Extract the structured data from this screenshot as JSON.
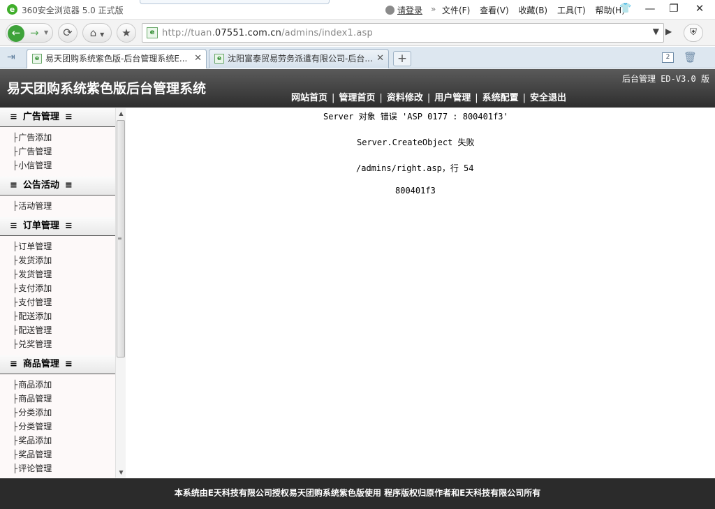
{
  "browser": {
    "title": "360安全浏览器 5.0 正式版",
    "login": "请登录",
    "menus": [
      "文件(F)",
      "查看(V)",
      "收藏(B)",
      "工具(T)",
      "帮助(H)"
    ],
    "url_prefix": "http://tuan.",
    "url_domain": "07551.com.cn",
    "url_path": "/admins/index1.asp",
    "tabs": [
      {
        "title": "易天团购系统紫色版-后台管理系统E...",
        "active": true
      },
      {
        "title": "沈阳富泰贸易劳务派遣有限公司-后台...",
        "active": false
      }
    ],
    "tab_count": "2",
    "icons": {
      "back": "back-arrow-icon",
      "forward": "forward-arrow-icon",
      "refresh": "refresh-icon",
      "home": "home-icon",
      "favorite": "star-icon",
      "security": "shield-icon"
    }
  },
  "header": {
    "system_title": "易天团购系统紫色版后台管理系统",
    "version_label": "后台管理",
    "version_code": "ED-V3.0 版",
    "nav": [
      "网站首页",
      "管理首页",
      "资料修改",
      "用户管理",
      "系统配置",
      "安全退出"
    ]
  },
  "sidebar": {
    "sections": [
      {
        "title": "广告管理",
        "items": [
          "广告添加",
          "广告管理",
          "小信管理"
        ]
      },
      {
        "title": "公告活动",
        "items": [
          "活动管理"
        ]
      },
      {
        "title": "订单管理",
        "items": [
          "订单管理",
          "发货添加",
          "发货管理",
          "支付添加",
          "支付管理",
          "配送添加",
          "配送管理",
          "兑奖管理"
        ]
      },
      {
        "title": "商品管理",
        "items": [
          "商品添加",
          "商品管理",
          "分类添加",
          "分类管理",
          "奖品添加",
          "奖品管理",
          "评论管理"
        ]
      }
    ]
  },
  "main": {
    "error_line1": "Server 对象 错误 'ASP 0177 : 800401f3'",
    "error_line2": "Server.CreateObject 失败",
    "error_line3": "/admins/right.asp，行 54",
    "error_line4": "800401f3"
  },
  "footer": {
    "text": "本系统由E天科技有限公司授权易天团购系统紫色版使用 程序版权归原作者和E天科技有限公司所有"
  }
}
